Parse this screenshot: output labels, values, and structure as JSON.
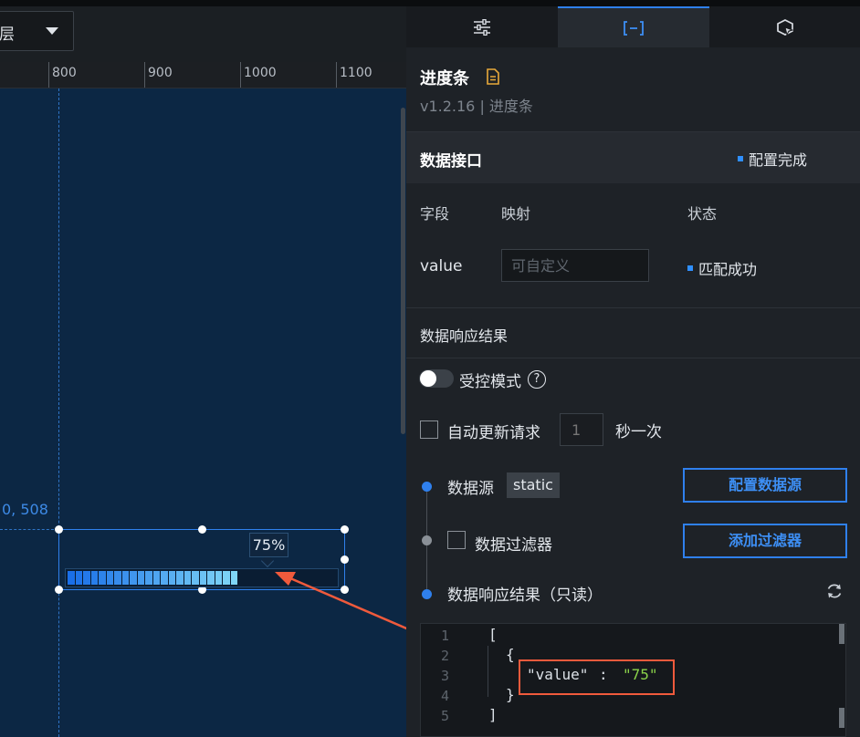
{
  "canvas": {
    "layer_select_label": "层",
    "ruler_ticks": [
      "800",
      "900",
      "1000",
      "1100"
    ],
    "coord_readout": "0, 508",
    "progress": {
      "value_label": "75%",
      "percent": 75,
      "colors": {
        "start": "#1a6fe8",
        "end": "#7fd6f7",
        "track": "#0a1d33"
      }
    }
  },
  "panel": {
    "tabs": [
      {
        "name": "settings-tab",
        "icon": "sliders-icon",
        "active": false
      },
      {
        "name": "data-tab",
        "icon": "bracket-data-icon",
        "active": true
      },
      {
        "name": "interaction-tab",
        "icon": "cursor-box-icon",
        "active": false
      }
    ],
    "component": {
      "title": "进度条",
      "version": "v1.2.16 | 进度条"
    },
    "data_api": {
      "title": "数据接口",
      "status": "配置完成",
      "columns": {
        "field": "字段",
        "mapping": "映射",
        "status": "状态"
      },
      "row": {
        "field": "value",
        "mapping_placeholder": "可自定义",
        "status": "匹配成功"
      }
    },
    "response": {
      "section_title": "数据响应结果",
      "controlled_mode": "受控模式",
      "auto_update_label": "自动更新请求",
      "interval_placeholder": "1",
      "interval_unit": "秒一次",
      "steps": {
        "source": {
          "label": "数据源",
          "badge": "static",
          "button": "配置数据源"
        },
        "filter": {
          "label": "数据过滤器",
          "button": "添加过滤器"
        },
        "result": {
          "label": "数据响应结果（只读）"
        }
      }
    },
    "editor": {
      "line_numbers": [
        "1",
        "2",
        "3",
        "4",
        "5"
      ],
      "lines": {
        "l1": "[",
        "l2": "{",
        "l3_key": "\"value\"",
        "l3_colon": ": ",
        "l3_value": "\"75\"",
        "l4": "}",
        "l5": "]"
      }
    }
  },
  "colors": {
    "accent": "#2f80ed",
    "annotation": "#f05a3c",
    "canvas_bg": "#0c2744",
    "panel_bg": "#1e2227",
    "json_string": "#8bd34a"
  }
}
